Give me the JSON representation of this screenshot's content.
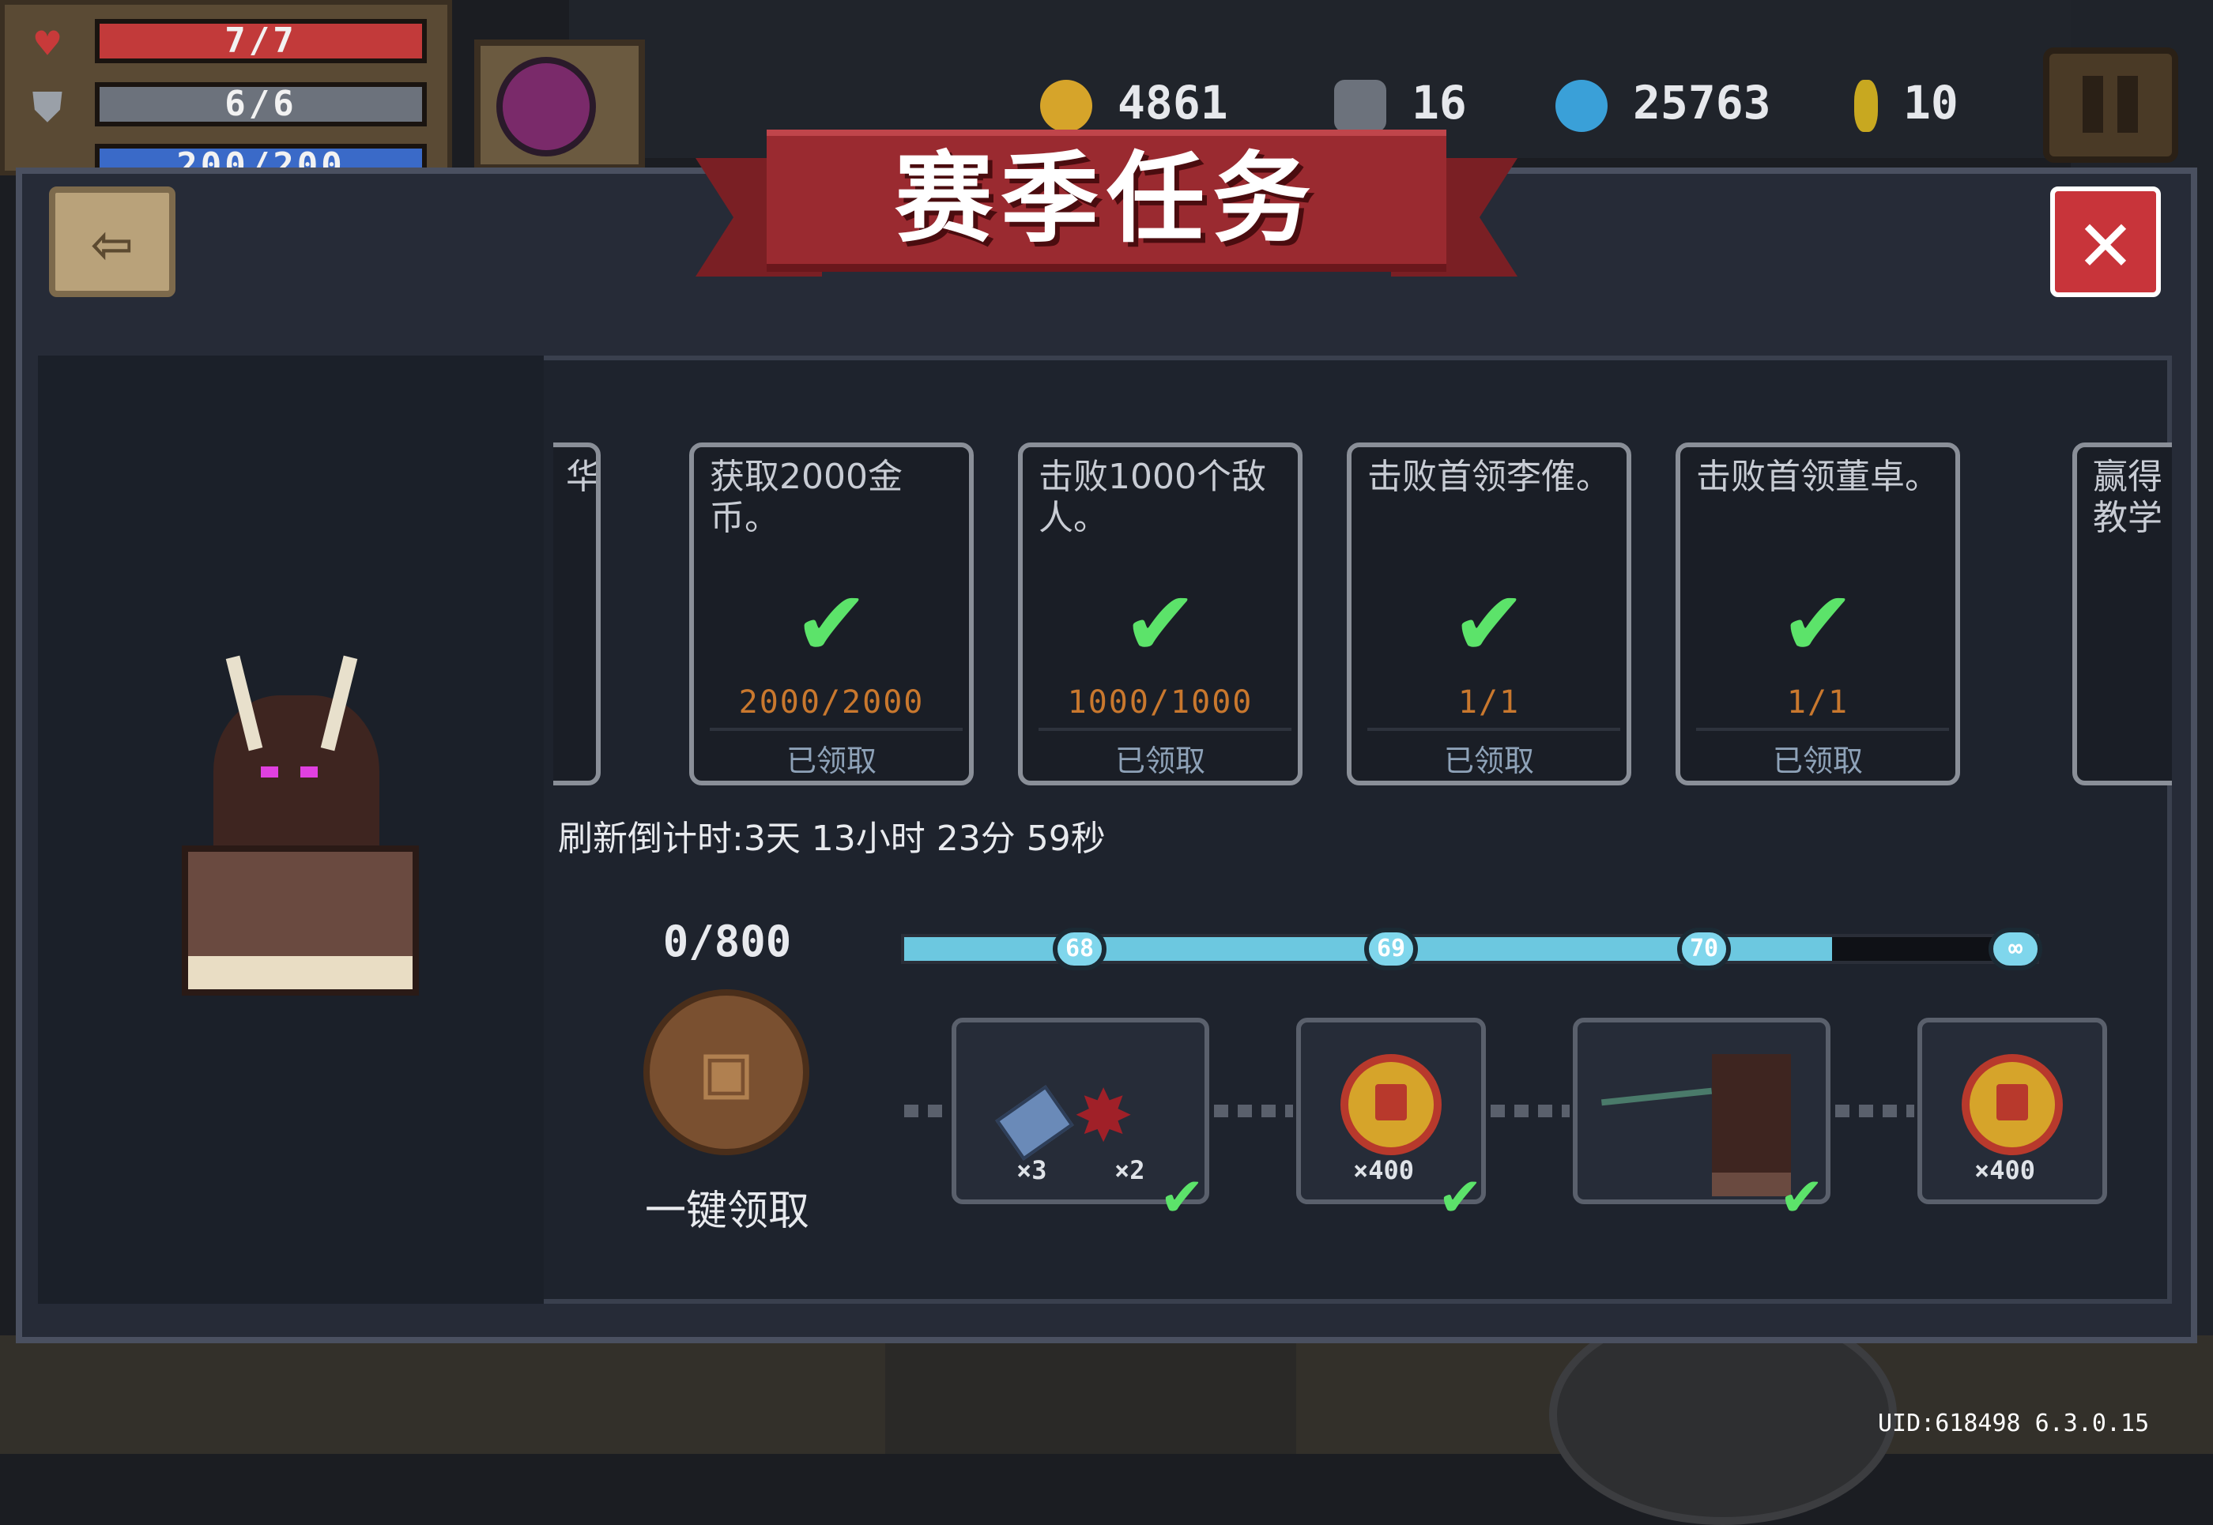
{
  "hud": {
    "health": "7/7",
    "armor": "6/6",
    "energy": "200/200",
    "currencies": [
      {
        "icon": "gold-coin-icon",
        "value": "4861"
      },
      {
        "icon": "fish-icon",
        "value": "16"
      },
      {
        "icon": "blue-gem-icon",
        "value": "25763"
      },
      {
        "icon": "seed-icon",
        "value": "10"
      }
    ]
  },
  "modal": {
    "title": "赛季任务",
    "back_icon": "⇦",
    "close_icon": "✕"
  },
  "tasks": [
    {
      "title": "华",
      "check": "",
      "progress": "",
      "status": ""
    },
    {
      "title": "获取2000金币。",
      "check": "✔",
      "progress": "2000/2000",
      "status": "已领取"
    },
    {
      "title": "击败1000个敌人。",
      "check": "✔",
      "progress": "1000/1000",
      "status": "已领取"
    },
    {
      "title": "击败首领李傕。",
      "check": "✔",
      "progress": "1/1",
      "status": "已领取"
    },
    {
      "title": "击败首领董卓。",
      "check": "✔",
      "progress": "1/1",
      "status": "已领取"
    },
    {
      "title": "赢得教学",
      "check": "",
      "progress": "",
      "status": ""
    }
  ],
  "countdown": "刷新倒计时:3天 13小时 23分 59秒",
  "progress": {
    "points": "0/800",
    "claim_all_label": "一键领取",
    "levels": [
      "68",
      "69",
      "70",
      "∞"
    ],
    "fill_fraction": 0.82
  },
  "rewards": [
    {
      "items": [
        {
          "name": "ticket",
          "count": "×3"
        },
        {
          "name": "maple-leaf",
          "count": "×2"
        }
      ],
      "claimed": true
    },
    {
      "items": [
        {
          "name": "gold-coin",
          "count": "×400"
        }
      ],
      "claimed": true
    },
    {
      "items": [
        {
          "name": "spear-and-boss-statue",
          "count": ""
        }
      ],
      "claimed": true
    },
    {
      "items": [
        {
          "name": "gold-coin",
          "count": "×400"
        }
      ],
      "claimed": false
    }
  ],
  "uid": "UID:618498 6.3.0.15",
  "colors": {
    "accent_green": "#5ce36a",
    "banner_red": "#9a2a30",
    "progress_blue": "#6cc8e0",
    "close_red": "#c8343a"
  }
}
